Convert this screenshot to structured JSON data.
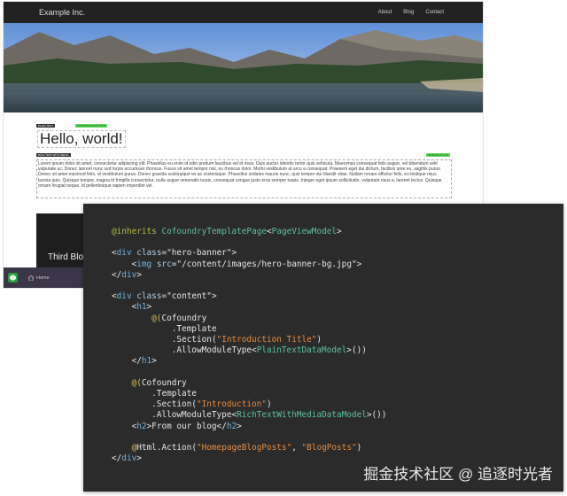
{
  "site": {
    "brand": "Example Inc.",
    "nav": [
      "About",
      "Blog",
      "Contact"
    ]
  },
  "editor_tags": {
    "plain_text": "PLAIN TEXT",
    "edit_region_1": "INTRODUCTION TITLE",
    "rich_text": "RICH TEXT WITH MEDIA",
    "edit_region_2": "INTRODUCTION"
  },
  "content": {
    "heading": "Hello, world!",
    "paragraph": "Lorem ipsum dolor sit amet, consectetur adipiscing elit. Phasellus eu enim id odio pretium faucibus vel id risus. Duis auctor lobortis tortor quis vehicula. Maecenas consequat felis augue, vel bibendum velit vulputate ac. Donec laoreet nunc sed turpis accumsan rhoncus. Fusce sit amet tempor nisi, eu rhoncus dolor. Morbi vestibulum at arcu a consequat. Praesent eget dui dictum, facilisis ante eu, sagittis purus. Donec sit amet euismod felis, ut vestibulum purus. Donec gravida scelerisque ex ac scelerisque. Phasellus sodales mauris nunc, quis tempor dui blandit vitae. Nullam ornare efficitur felis, eu tristique risus lacinia quis. Quisque tempor, magna id fringilla consectetur, nulla augue venenatis turpis, consequat congue justo eros semper turpis. Integer eget ipsum sollicitudin, vulputate risus a, laoreet lectus. Quisque ornare feugiat neque, id pellentesque sapien imperdiet vel.",
    "third_blog": "Third Blog"
  },
  "admin_bar": {
    "home_label": "Home"
  },
  "watermark": "掘金技术社区 @ 追逐时光者"
}
